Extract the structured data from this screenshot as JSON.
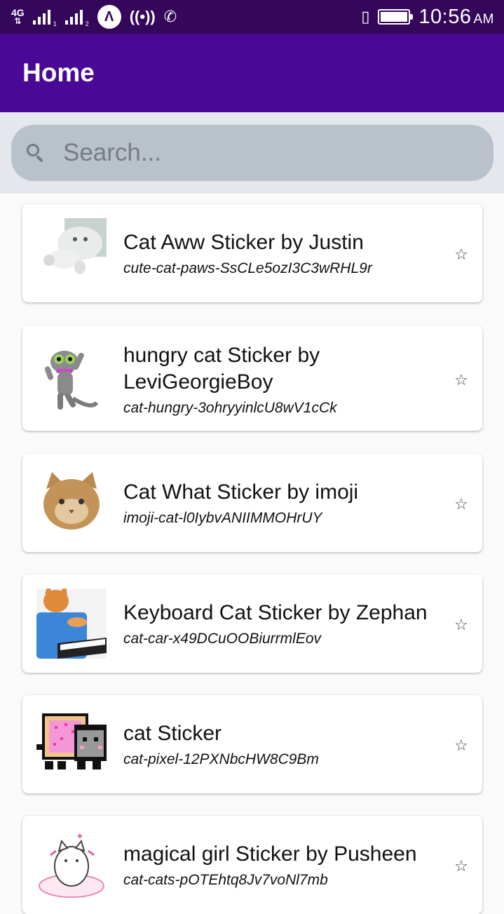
{
  "status_bar": {
    "network": "4G",
    "sim1": "1",
    "sim2": "2",
    "time": "10:56",
    "ampm": "AM"
  },
  "app_bar": {
    "title": "Home"
  },
  "search": {
    "placeholder": "Search...",
    "value": ""
  },
  "stickers": [
    {
      "title": "Cat Aww Sticker by Justin",
      "slug": "cute-cat-paws-SsCLe5ozI3C3wRHL9r",
      "favorite_icon": "star-outline-icon"
    },
    {
      "title": "hungry cat Sticker by LeviGeorgieBoy",
      "slug": "cat-hungry-3ohryyinlcU8wV1cCk",
      "favorite_icon": "star-outline-icon"
    },
    {
      "title": "Cat What Sticker by imoji",
      "slug": "imoji-cat-l0IybvANIIMMOHrUY",
      "favorite_icon": "star-outline-icon"
    },
    {
      "title": "Keyboard Cat Sticker by Zephan",
      "slug": "cat-car-x49DCuOOBiurrmlEov",
      "favorite_icon": "star-outline-icon"
    },
    {
      "title": "cat Sticker",
      "slug": "cat-pixel-12PXNbcHW8C9Bm",
      "favorite_icon": "star-outline-icon"
    },
    {
      "title": "magical girl Sticker by Pusheen",
      "slug": "cat-cats-pOTEhtq8Jv7voNl7mb",
      "favorite_icon": "star-outline-icon"
    }
  ],
  "colors": {
    "status_bar": "#34075a",
    "app_bar": "#4a0896",
    "search_area": "#e4e7ec",
    "search_box": "#b9c1ca"
  }
}
